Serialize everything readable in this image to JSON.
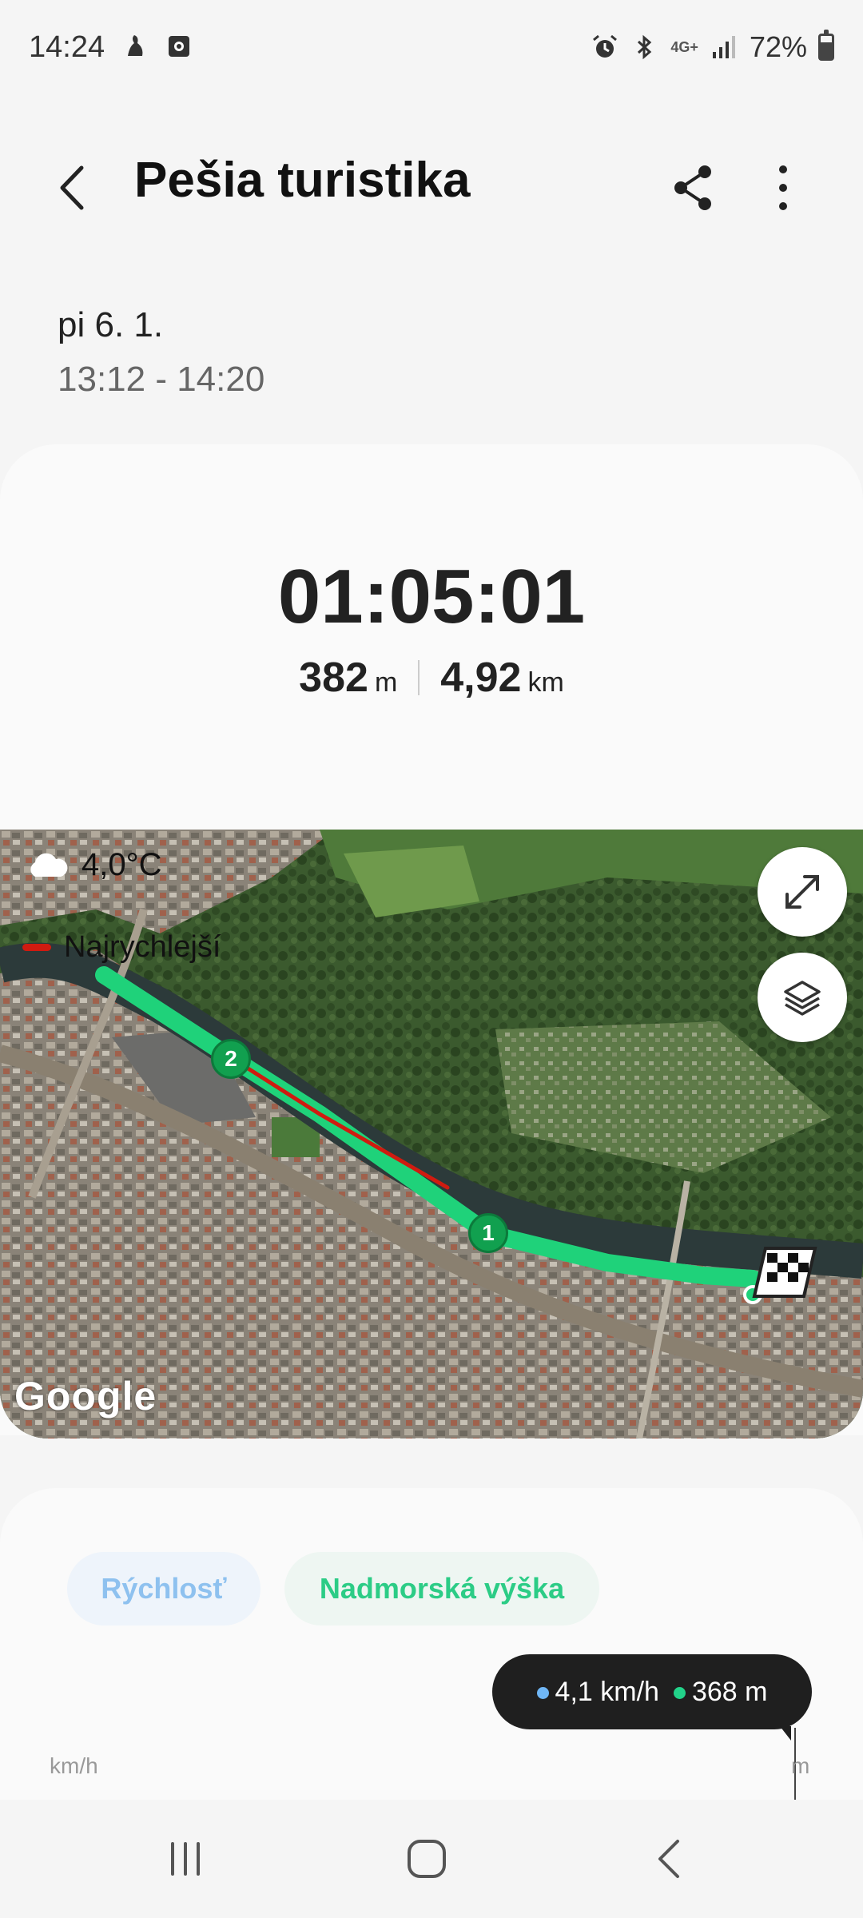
{
  "status_bar": {
    "time": "14:24",
    "battery": "72%",
    "network": "4G+",
    "icons": [
      "notification-icon",
      "screen-record-icon",
      "alarm-icon",
      "bluetooth-icon",
      "network-icon",
      "signal-icon",
      "battery-icon"
    ]
  },
  "header": {
    "title": "Pešia turistika",
    "icons": [
      "back-icon",
      "share-icon",
      "more-options-icon"
    ]
  },
  "workout": {
    "date": "pi 6. 1.",
    "time_range": "13:12 - 14:20",
    "duration": "01:05:01",
    "elevation_value": "382",
    "elevation_unit": "m",
    "distance_value": "4,92",
    "distance_unit": "km"
  },
  "map": {
    "weather_text": "4,0°C",
    "weather_icon": "cloud-icon",
    "legend_label": "Najrychlejší",
    "legend_color": "#d01b10",
    "route_color": "#1fd27a",
    "markers": [
      "1",
      "2"
    ],
    "attribution": "Google",
    "buttons": [
      "expand-icon",
      "layers-icon"
    ]
  },
  "chart": {
    "tabs": [
      "Rýchlosť",
      "Nadmorská výška"
    ],
    "tooltip_speed": "4,1 km/h",
    "tooltip_altitude": "368 m",
    "speed_color": "#6fb6f5",
    "altitude_color": "#22d38a",
    "left_axis_unit": "km/h",
    "right_axis_unit": "m"
  },
  "nav_bar": {
    "buttons": [
      "recent-apps-icon",
      "home-icon",
      "back-nav-icon"
    ]
  }
}
